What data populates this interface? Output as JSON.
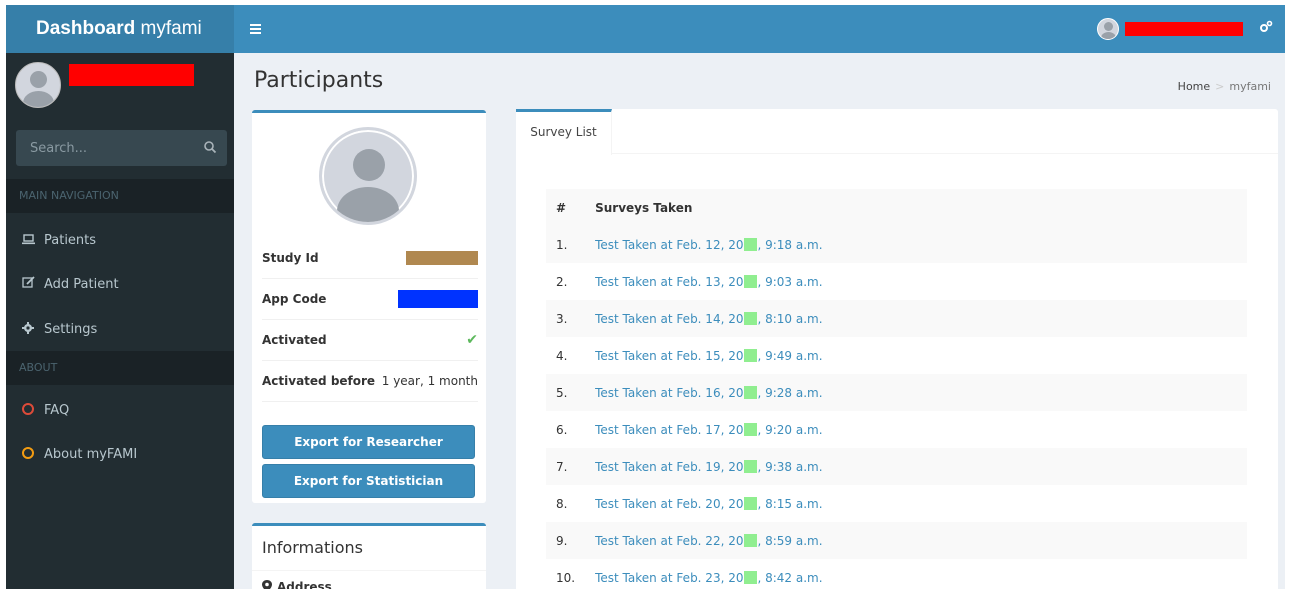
{
  "header": {
    "logo_bold": "Dashboard",
    "logo_light": "myfami",
    "menu_icon": "hamburger-icon",
    "settings_icon": "gears-icon"
  },
  "sidebar": {
    "search_placeholder": "Search...",
    "nav_header_main": "MAIN NAVIGATION",
    "items": [
      {
        "label": "Patients",
        "icon": "laptop-icon"
      },
      {
        "label": "Add Patient",
        "icon": "edit-icon"
      },
      {
        "label": "Settings",
        "icon": "gear-icon"
      }
    ],
    "nav_header_about": "ABOUT",
    "about_items": [
      {
        "label": "FAQ",
        "icon": "circle-icon",
        "color": "#dd4b39"
      },
      {
        "label": "About myFAMI",
        "icon": "circle-icon",
        "color": "#f39c12"
      }
    ]
  },
  "page": {
    "title": "Participants",
    "breadcrumb_home": "Home",
    "breadcrumb_sep": ">",
    "breadcrumb_current": "myfami"
  },
  "profile": {
    "study_id_label": "Study Id",
    "study_id_color": "#b08850",
    "app_code_label": "App Code",
    "app_code_color": "#0033ff",
    "activated_label": "Activated",
    "activated_value": "✔",
    "activated_before_label": "Activated before",
    "activated_before_value": "1 year, 1 month",
    "export_researcher": "Export for Researcher",
    "export_statistician": "Export for Statistician"
  },
  "informations": {
    "title": "Informations",
    "address_label": "Address"
  },
  "surveys": {
    "tab_label": "Survey List",
    "col_num": "#",
    "col_taken": "Surveys Taken",
    "rows": [
      {
        "num": "1.",
        "prefix": "Test Taken at Feb. 12, 20",
        "suffix": ", 9:18 a.m."
      },
      {
        "num": "2.",
        "prefix": "Test Taken at Feb. 13, 20",
        "suffix": ", 9:03 a.m."
      },
      {
        "num": "3.",
        "prefix": "Test Taken at Feb. 14, 20",
        "suffix": ", 8:10 a.m."
      },
      {
        "num": "4.",
        "prefix": "Test Taken at Feb. 15, 20",
        "suffix": ", 9:49 a.m."
      },
      {
        "num": "5.",
        "prefix": "Test Taken at Feb. 16, 20",
        "suffix": ", 9:28 a.m."
      },
      {
        "num": "6.",
        "prefix": "Test Taken at Feb. 17, 20",
        "suffix": ", 9:20 a.m."
      },
      {
        "num": "7.",
        "prefix": "Test Taken at Feb. 19, 20",
        "suffix": ", 9:38 a.m."
      },
      {
        "num": "8.",
        "prefix": "Test Taken at Feb. 20, 20",
        "suffix": ", 8:15 a.m."
      },
      {
        "num": "9.",
        "prefix": "Test Taken at Feb. 22, 20",
        "suffix": ", 8:59 a.m."
      },
      {
        "num": "10.",
        "prefix": "Test Taken at Feb. 23, 20",
        "suffix": ", 8:42 a.m."
      }
    ]
  }
}
